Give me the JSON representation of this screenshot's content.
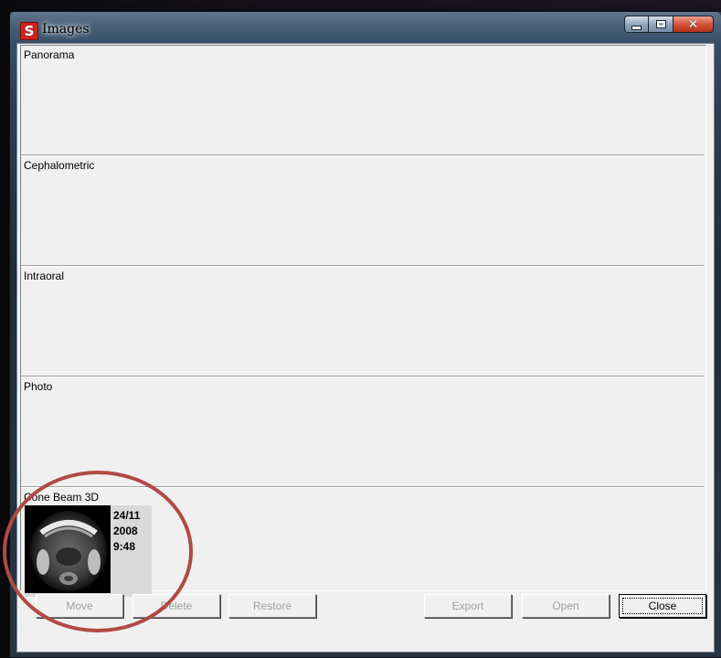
{
  "window": {
    "title": "Images",
    "app_icon_letter": "S"
  },
  "categories": [
    {
      "label": "Panorama"
    },
    {
      "label": "Cephalometric"
    },
    {
      "label": "Intraoral"
    },
    {
      "label": "Photo"
    },
    {
      "label": "Cone Beam 3D"
    }
  ],
  "thumbnail": {
    "date_day_month": "24/11",
    "date_year": "2008",
    "time": "9:48"
  },
  "buttons": {
    "move": "Move",
    "delete": "Delete",
    "restore": "Restore",
    "export": "Export",
    "open": "Open",
    "close": "Close"
  },
  "colors": {
    "annotation": "#b04a43",
    "app_icon": "#c8261e"
  }
}
